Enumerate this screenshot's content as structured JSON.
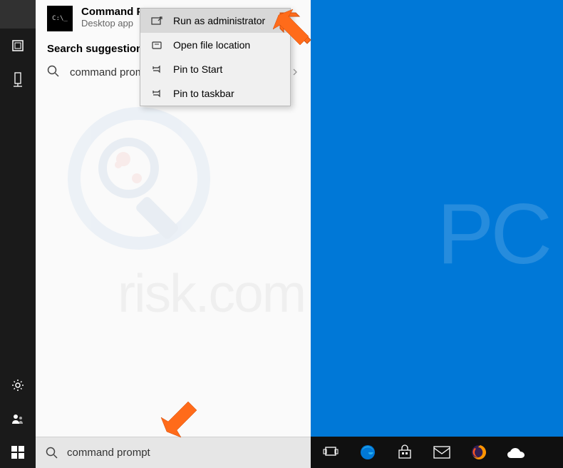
{
  "search": {
    "best_match": {
      "title": "Command Prompt",
      "subtitle": "Desktop app"
    },
    "section_label": "Search suggestions",
    "suggestion": "command prompt",
    "input_value": "command prompt"
  },
  "context_menu": {
    "items": [
      {
        "label": "Run as administrator",
        "icon": "admin-icon",
        "highlighted": true
      },
      {
        "label": "Open file location",
        "icon": "folder-icon",
        "highlighted": false
      },
      {
        "label": "Pin to Start",
        "icon": "pin-icon",
        "highlighted": false
      },
      {
        "label": "Pin to taskbar",
        "icon": "pin-icon",
        "highlighted": false
      }
    ]
  },
  "watermark": {
    "badge_text": "risk.com",
    "big_text": "PC"
  }
}
